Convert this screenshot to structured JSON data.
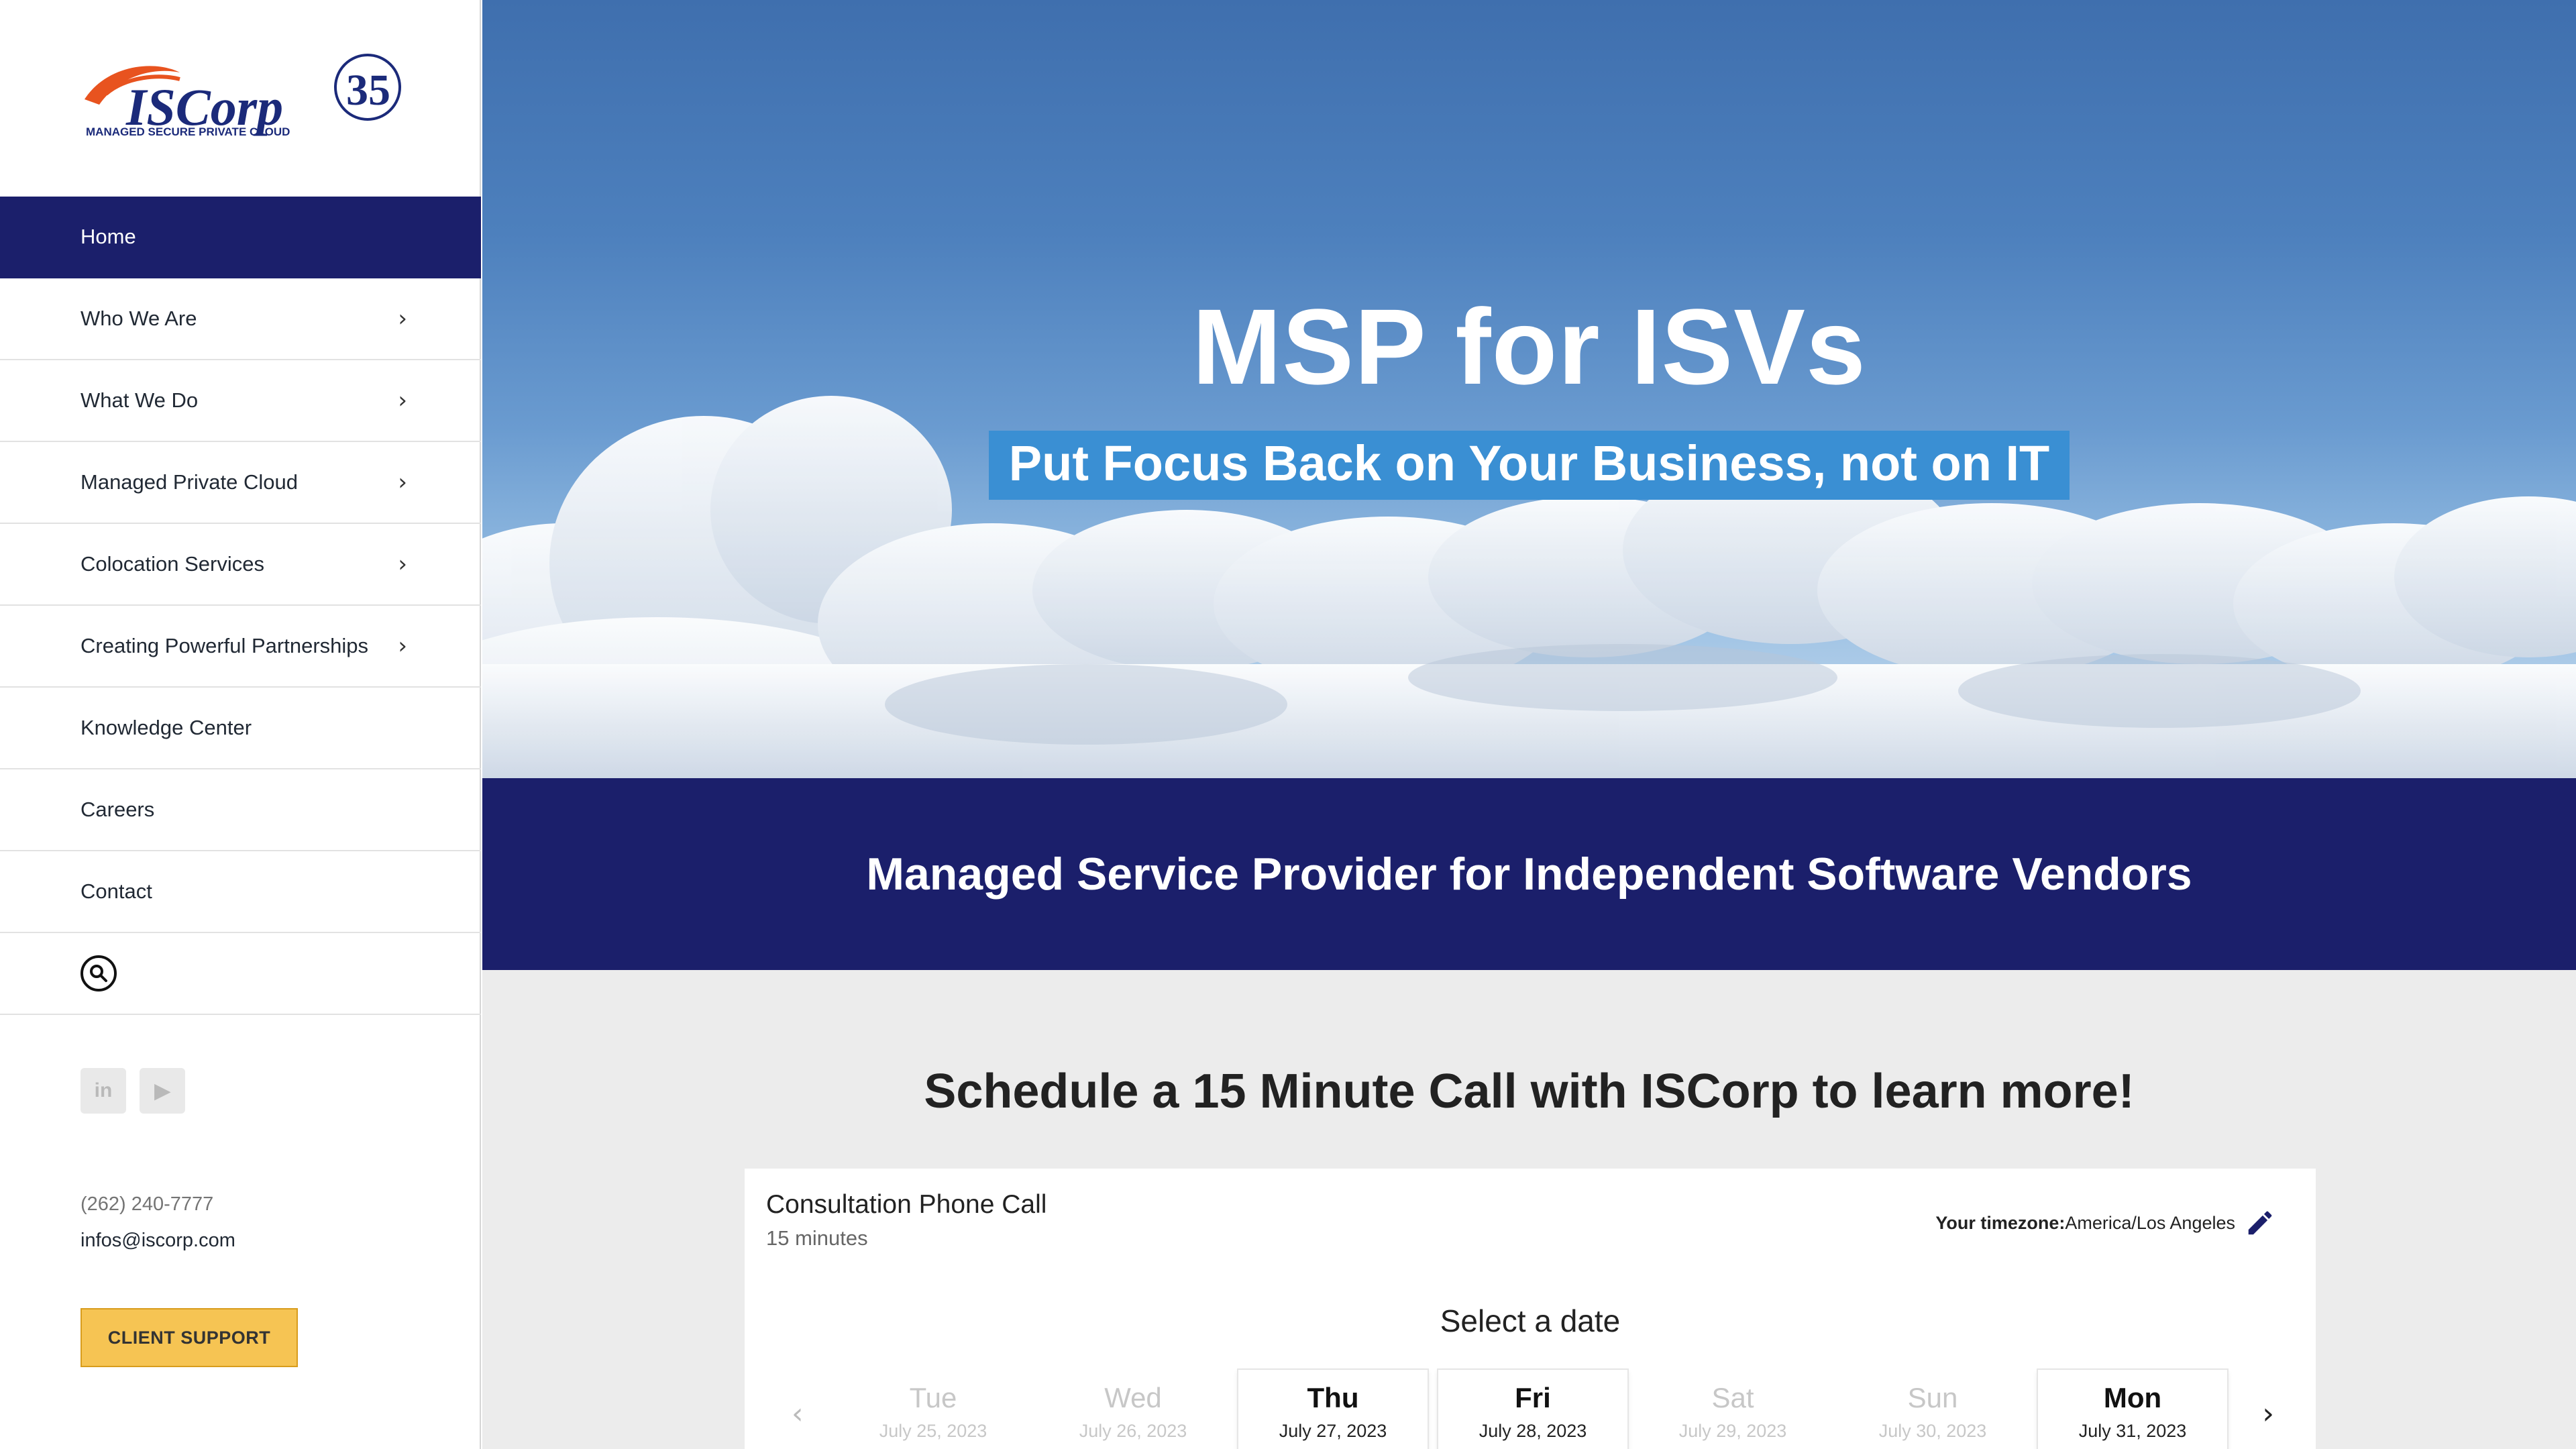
{
  "sidebar": {
    "logo": {
      "text": "ISCorp",
      "tagline": "MANAGED SECURE PRIVATE CLOUD",
      "badge": "35"
    },
    "nav": [
      {
        "label": "Home",
        "active": true,
        "has_children": false
      },
      {
        "label": "Who We Are",
        "active": false,
        "has_children": true
      },
      {
        "label": "What We Do",
        "active": false,
        "has_children": true
      },
      {
        "label": "Managed Private Cloud",
        "active": false,
        "has_children": true
      },
      {
        "label": "Colocation Services",
        "active": false,
        "has_children": true
      },
      {
        "label": "Creating Powerful Partnerships",
        "active": false,
        "has_children": true
      },
      {
        "label": "Knowledge Center",
        "active": false,
        "has_children": false
      },
      {
        "label": "Careers",
        "active": false,
        "has_children": false
      },
      {
        "label": "Contact",
        "active": false,
        "has_children": false
      }
    ],
    "social": {
      "linkedin": "in",
      "youtube": "▶"
    },
    "phone": "(262) 240-7777",
    "email": "infos@iscorp.com",
    "client_support_label": "CLIENT SUPPORT"
  },
  "hero": {
    "title": "MSP for ISVs",
    "subtitle": "Put Focus Back on Your Business, not on IT"
  },
  "banner": {
    "text": "Managed Service Provider for Independent Software Vendors"
  },
  "schedule": {
    "heading_prefix": "Schedule a ",
    "heading_bold": "15 Minute Call",
    "heading_suffix": " with ISCorp to learn more!",
    "card": {
      "title": "Consultation Phone Call",
      "duration": "15 minutes",
      "timezone_label": "Your timezone:",
      "timezone_value": "America/Los Angeles",
      "select_date": "Select a date",
      "days": [
        {
          "name": "Tue",
          "date": "July 25, 2023",
          "available": false
        },
        {
          "name": "Wed",
          "date": "July 26, 2023",
          "available": false
        },
        {
          "name": "Thu",
          "date": "July 27, 2023",
          "available": true
        },
        {
          "name": "Fri",
          "date": "July 28, 2023",
          "available": true
        },
        {
          "name": "Sat",
          "date": "July 29, 2023",
          "available": false
        },
        {
          "name": "Sun",
          "date": "July 30, 2023",
          "available": false
        },
        {
          "name": "Mon",
          "date": "July 31, 2023",
          "available": true
        }
      ]
    }
  },
  "colors": {
    "navy": "#1b1f6b",
    "accent_blue": "#3a8fd3",
    "support_yellow": "#f6c453",
    "logo_orange": "#e8531f"
  }
}
